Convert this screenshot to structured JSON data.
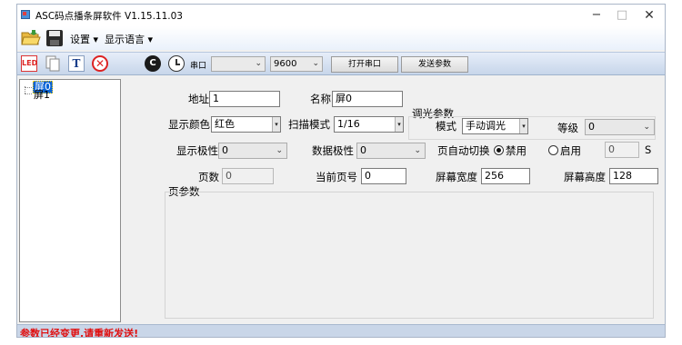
{
  "window": {
    "title": "ASC码点播条屏软件 V1.15.11.03",
    "controls": {
      "minimize": "−",
      "maximize": "□",
      "close": "✕"
    }
  },
  "menubar": {
    "settings": "设置 ▾",
    "language": "显示语言 ▾"
  },
  "toolbar": {
    "icons": [
      "led-icon",
      "copy-icon",
      "text-icon",
      "delete-icon",
      "color-icon",
      "clock-icon"
    ],
    "led_text": "LED",
    "text_icon_letter": "T",
    "delete_icon_glyph": "✕",
    "color_icon_text": "C",
    "port_label": "串口",
    "port_value": "",
    "baud_value": "9600",
    "open_port_button": "打开串口",
    "send_params_button": "发送参数"
  },
  "tree": {
    "items": [
      {
        "label": "屏0",
        "selected": true
      },
      {
        "label": "屏1",
        "selected": false
      }
    ]
  },
  "form": {
    "address_label": "地址",
    "address_value": "1",
    "name_label": "名称",
    "name_value": "屏0",
    "color_label": "显示颜色",
    "color_value": "红色",
    "scan_label": "扫描模式",
    "scan_value": "1/16",
    "dim_group_label": "调光参数",
    "mode_label": "模式",
    "mode_value": "手动调光",
    "level_label": "等级",
    "level_value": "0",
    "polarity_label": "显示极性",
    "polarity_value": "0",
    "data_polarity_label": "数据极性",
    "data_polarity_value": "0",
    "auto_switch_label": "页自动切换",
    "disable_label": "禁用",
    "enable_label": "启用",
    "auto_switch_selected": "禁用",
    "seconds_value": "0",
    "seconds_unit": "S",
    "pages_label": "页数",
    "pages_value": "0",
    "current_page_label": "当前页号",
    "current_page_value": "0",
    "screen_width_label": "屏幕宽度",
    "screen_width_value": "256",
    "screen_height_label": "屏幕高度",
    "screen_height_value": "128",
    "page_params_label": "页参数"
  },
  "status": {
    "message": "参数已经变更,请重新发送!",
    "message_color": "#e01010"
  },
  "colors": {
    "toolbar_bg": "#c7d6ea",
    "selected_tree_bg": "#0a64d6",
    "statusbar_bg": "#c9d6e8"
  }
}
